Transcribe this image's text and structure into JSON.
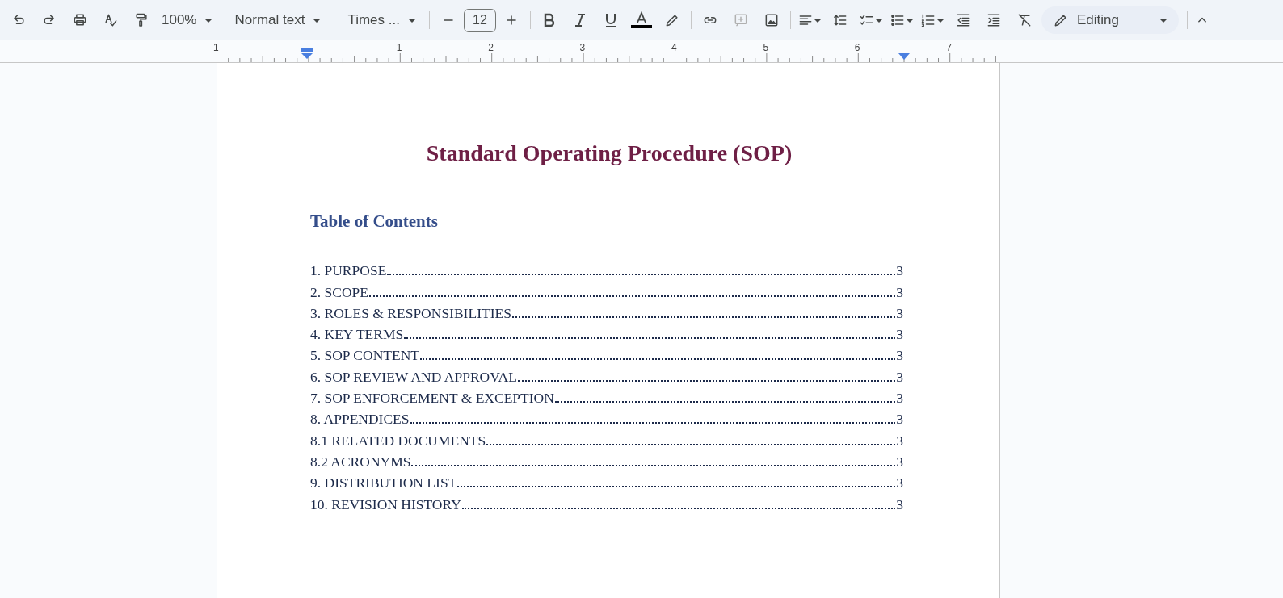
{
  "toolbar": {
    "zoom": "100%",
    "paragraph_style": "Normal text",
    "font": "Times ...",
    "font_size": "12",
    "mode": "Editing"
  },
  "ruler": {
    "labels": [
      "1",
      "1",
      "2",
      "3",
      "4",
      "5",
      "6",
      "7"
    ]
  },
  "document": {
    "title": "Standard Operating Procedure (SOP)",
    "toc_heading": "Table of Contents",
    "toc": [
      {
        "title": "1. PURPOSE",
        "page": "3"
      },
      {
        "title": "2. SCOPE",
        "page": "3"
      },
      {
        "title": "3. ROLES & RESPONSIBILITIES",
        "page": "3"
      },
      {
        "title": "4. KEY TERMS",
        "page": "3"
      },
      {
        "title": "5. SOP CONTENT",
        "page": "3"
      },
      {
        "title": "6. SOP REVIEW AND APPROVAL",
        "page": "3"
      },
      {
        "title": "7. SOP ENFORCEMENT & EXCEPTION",
        "page": "3"
      },
      {
        "title": "8. APPENDICES",
        "page": "3"
      },
      {
        "title": "8.1 RELATED DOCUMENTS",
        "page": "3"
      },
      {
        "title": "8.2 ACRONYMS",
        "page": "3"
      },
      {
        "title": "9. DISTRIBUTION LIST",
        "page": "3"
      },
      {
        "title": "10. REVISION HISTORY",
        "page": "3"
      }
    ]
  }
}
